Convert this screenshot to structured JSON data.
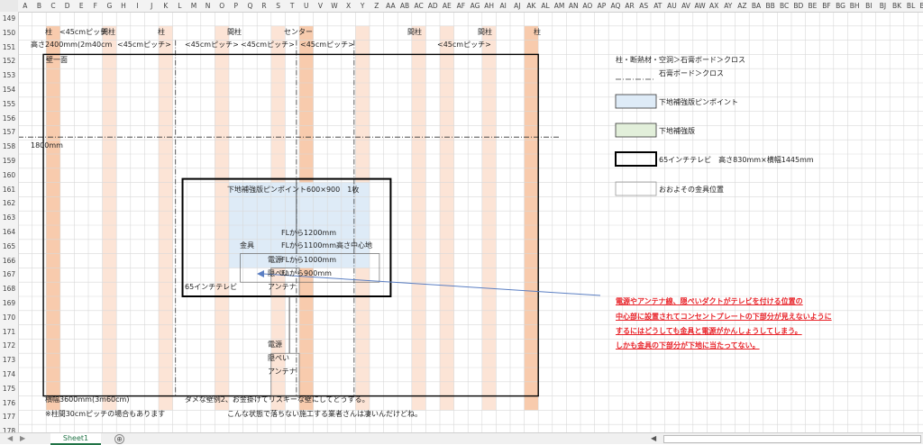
{
  "sheet": {
    "columns": [
      "A",
      "B",
      "C",
      "D",
      "E",
      "F",
      "G",
      "H",
      "I",
      "J",
      "K",
      "L",
      "M",
      "N",
      "O",
      "P",
      "Q",
      "R",
      "S",
      "T",
      "U",
      "V",
      "W",
      "X",
      "Y",
      "Z",
      "AA",
      "AB",
      "AC",
      "AD",
      "AE",
      "AF",
      "AG",
      "AH",
      "AI",
      "AJ",
      "AK",
      "AL",
      "AM",
      "AN",
      "AO",
      "AP",
      "AQ",
      "AR",
      "AS",
      "AT",
      "AU",
      "AV",
      "AW",
      "AX",
      "AY",
      "AZ",
      "BA",
      "BB",
      "BC",
      "BD",
      "BE",
      "BF",
      "BG",
      "BH",
      "BI",
      "BJ",
      "BK",
      "BL",
      "BM"
    ],
    "rows": [
      "149",
      "150",
      "151",
      "152",
      "153",
      "154",
      "155",
      "156",
      "157",
      "158",
      "159",
      "160",
      "161",
      "162",
      "163",
      "164",
      "165",
      "166",
      "167",
      "168",
      "169",
      "170",
      "171",
      "172",
      "173",
      "174",
      "175",
      "176",
      "177",
      "178"
    ],
    "colors": {
      "gridline": "#d9d9d9",
      "header_bg": "#f3f3f3",
      "stud_light": "#fce4d6",
      "stud_dark": "#f8cbad",
      "pinpoint_blue": "#deebf7",
      "board_green": "#e2efda",
      "arrow_blue": "#5b7fc3",
      "note_red": "#e8242a",
      "excel_green": "#217346"
    }
  },
  "labels": {
    "pillar1": "柱",
    "pitch1": "<45cmピッチ",
    "mabashira1": "間柱",
    "pitch2": "<45cmピッチ>",
    "pillar2": "柱",
    "pitch3": "<45cmピッチ>",
    "mabashira2": "間柱",
    "pitch4": "<45cmピッチ>",
    "center": "センター",
    "pitch5": "<45cmピッチ>",
    "mabashira3": "間柱",
    "pitch6": "<45cmピッチ>",
    "mabashira4": "間柱",
    "pillar3": "柱",
    "height_label": "高さ2400mm(2m40cm",
    "wall_label": "壁一面",
    "height_1800": "1800mm",
    "width_label": "横幅3600mm(3m60cm)",
    "dame_label": "ダメな壁例2、お金掛けてリスキーな壁にしてどうする。",
    "stud_note": "※柱間30cmピッチの場合もあります",
    "bad_builder": "こんな状態で落ちない施工する業者さんは凄いんだけどね。"
  },
  "legend": {
    "title": "柱・断熱材・空洞＞石膏ボード＞クロス",
    "gypsum": "石膏ボード＞クロス",
    "pinpoint": "下地補強版ピンポイント",
    "board": "下地補強版",
    "tv": "65インチテレビ　高さ830mm×横幅1445mm",
    "fitting": "おおよその金具位置"
  },
  "diagram": {
    "pinpoint_title": "下地補強版ピンポイント600×900　1枚",
    "fl1200": "FLから1200mm",
    "kanagu": "金具",
    "fl1100": "FLから1100mm高さ中心地",
    "fl1000": "FLから1000mm",
    "fl900": "FLから900mm",
    "tv_label": "65インチテレビ",
    "dengen1": "電源",
    "inpei1": "隠ぺい",
    "antenna1": "アンテナ",
    "dengen2": "電源",
    "inpei2": "隠ぺい",
    "antenna2": "アンテナ"
  },
  "note": {
    "line1": "電源やアンテナ線、隠ぺいダクトがテレビを付ける位置の",
    "line2": "中心部に設置されてコンセントプレートの下部分が見えないように",
    "line3": "するにはどうしても金具と電源がかんしょうしてしまう。",
    "line4": "しかも金具の下部分が下地に当たってない。"
  },
  "tabs": {
    "sheet1": "Sheet1",
    "add_icon": "⊕",
    "prev_icon": "◀",
    "next_icon": "▶"
  }
}
